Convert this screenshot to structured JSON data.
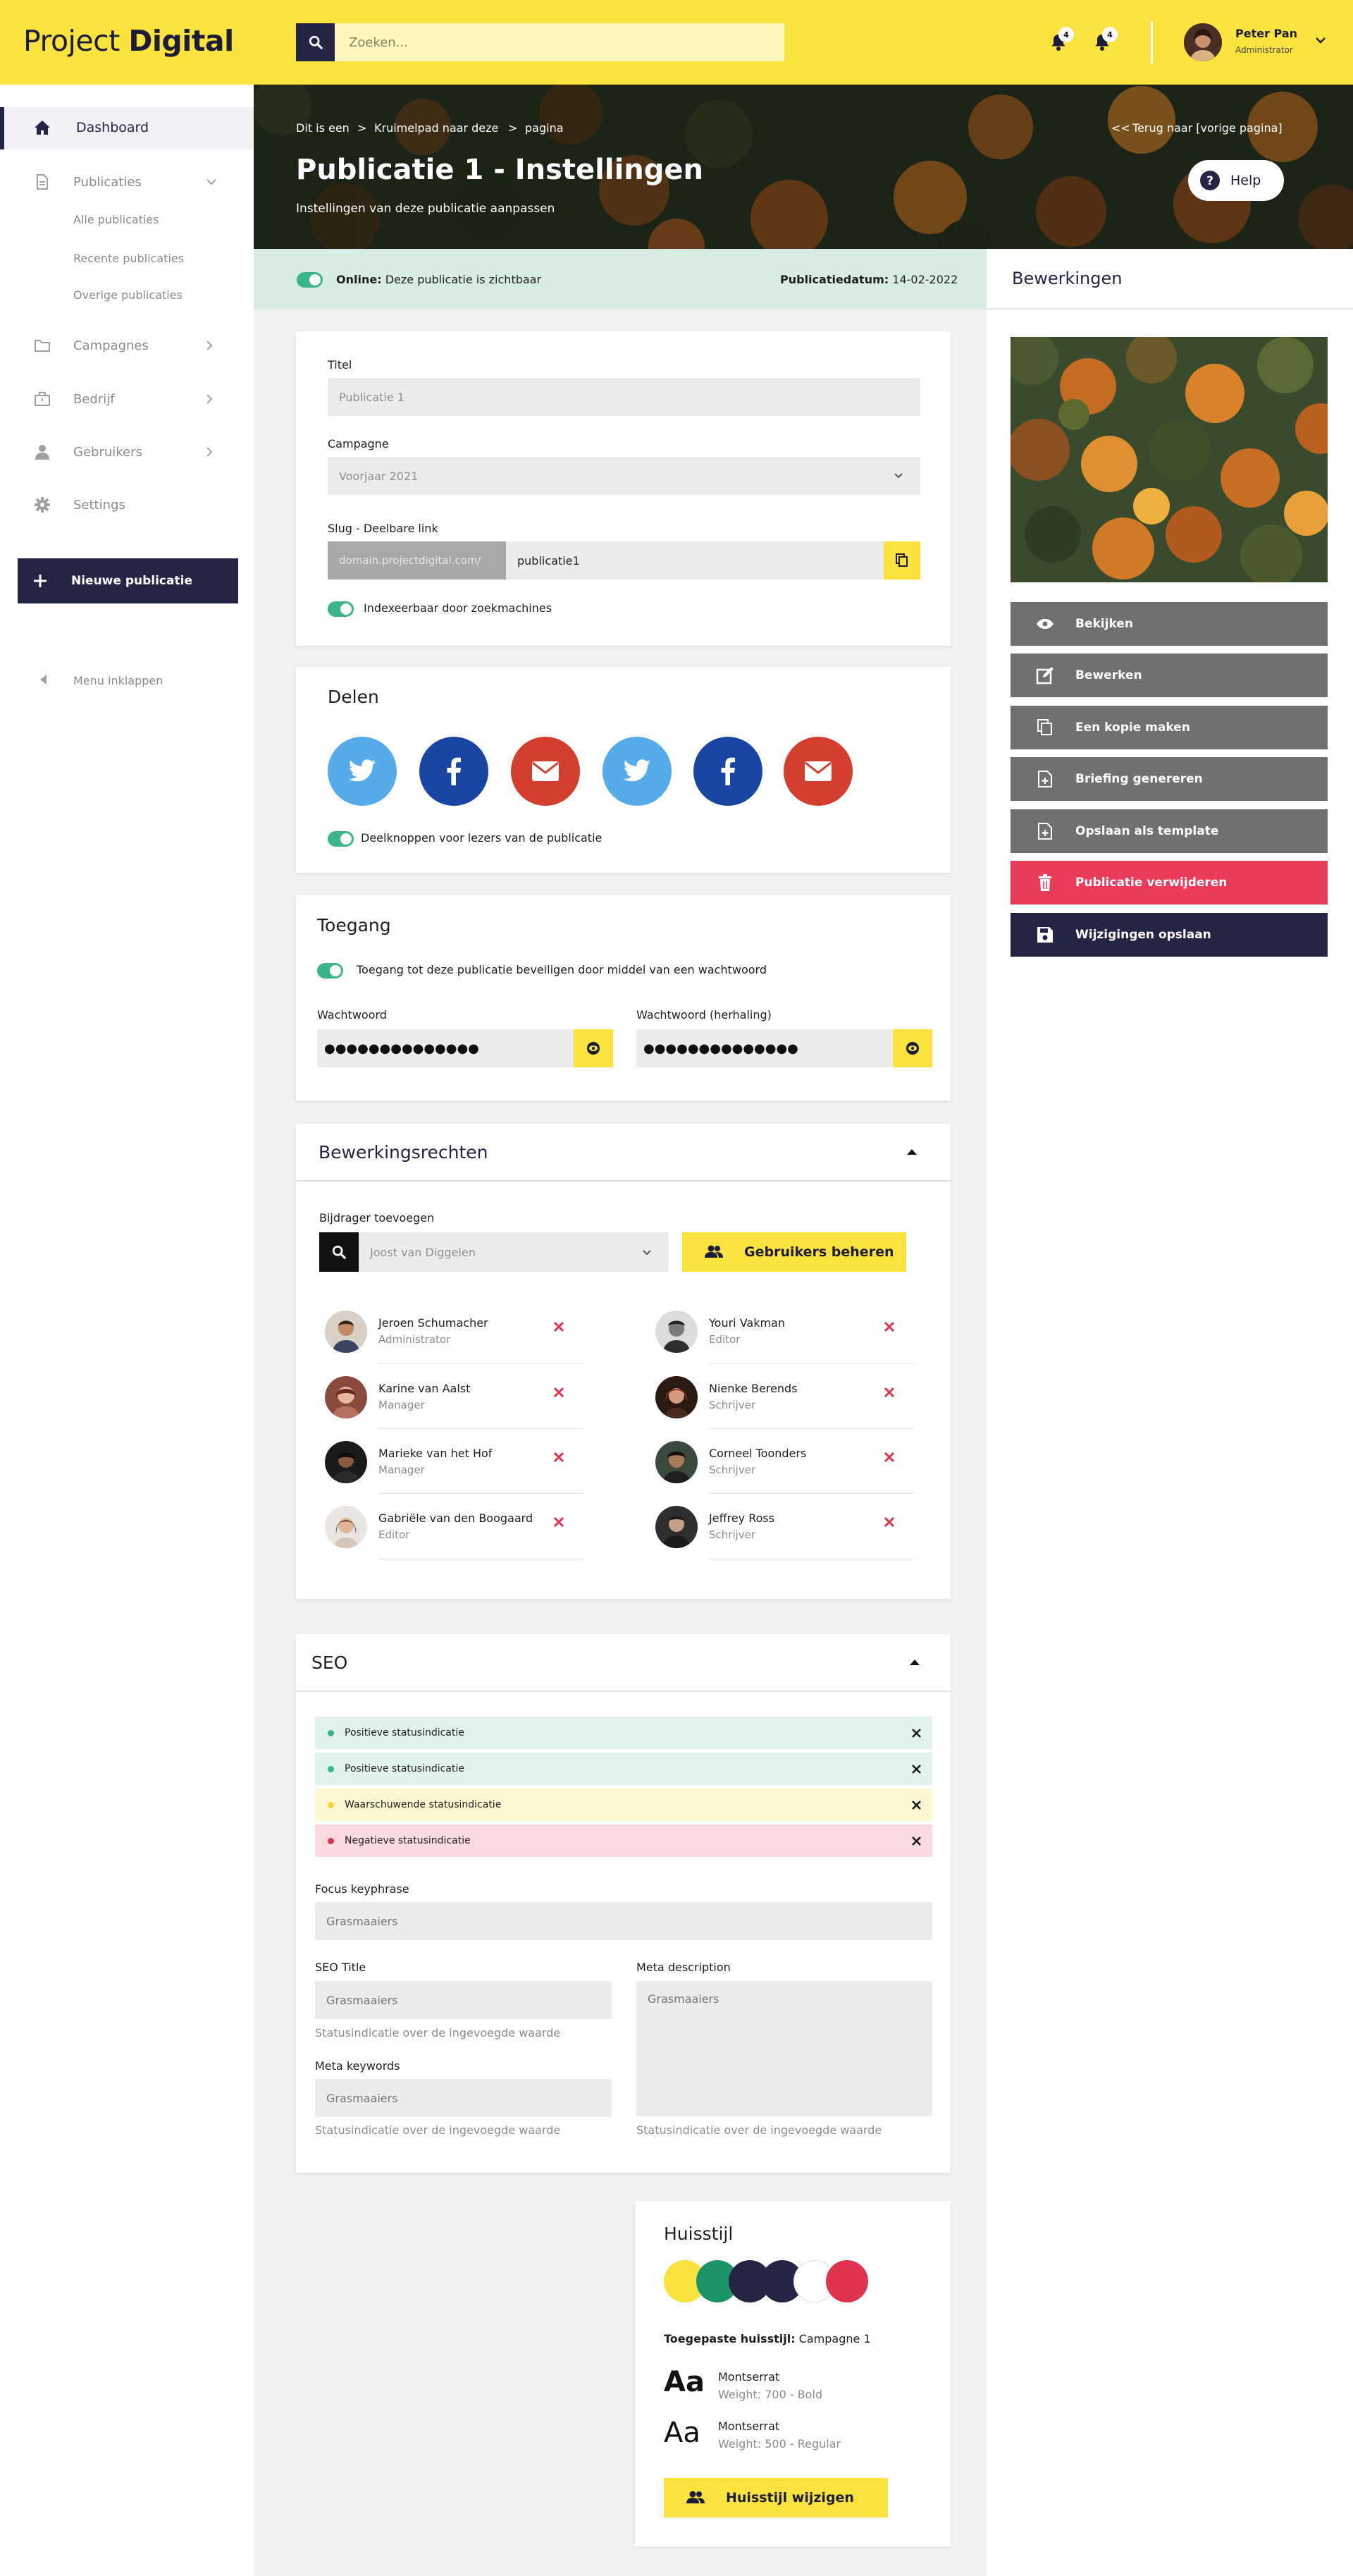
{
  "header": {
    "logo_light": "Project",
    "logo_bold": "Digital",
    "search_placeholder": "Zoeken...",
    "notif1_count": "4",
    "notif2_count": "4",
    "user_name": "Peter Pan",
    "user_role": "Administrator"
  },
  "sidebar": {
    "dashboard": "Dashboard",
    "publicaties": "Publicaties",
    "sub": [
      "Alle publicaties",
      "Recente publicaties",
      "Overige publicaties"
    ],
    "campagnes": "Campagnes",
    "bedrijf": "Bedrijf",
    "gebruikers": "Gebruikers",
    "settings": "Settings",
    "new_button": "Nieuwe publicatie",
    "collapse": "Menu inklappen"
  },
  "hero": {
    "crumb1": "Dit is een",
    "crumb2": "Kruimelpad naar deze",
    "crumb3": "pagina",
    "sep": ">",
    "back_arrows": "<<",
    "back": "Terug naar [vorige pagina]",
    "title": "Publicatie 1 - Instellingen",
    "subtitle": "Instellingen van deze publicatie aanpassen",
    "help": "Help"
  },
  "status": {
    "online_label": "Online:",
    "online_text": "Deze publicatie is zichtbaar",
    "date_label": "Publicatiedatum:",
    "date_value": "14-02-2022"
  },
  "general": {
    "title_label": "Titel",
    "title_value": "Publicatie 1",
    "campaign_label": "Campagne",
    "campaign_value": "Voorjaar 2021",
    "slug_label": "Slug - Deelbare link",
    "slug_prefix": "domain.projectdigital.com/",
    "slug_value": "publicatie1",
    "index_label": "Indexeerbaar door zoekmachines"
  },
  "share": {
    "title": "Delen",
    "toggle_label": "Deelknoppen voor lezers van de publicatie",
    "colors": {
      "twitter": "#56abe9",
      "facebook": "#1a45a3",
      "mail": "#d33e2e"
    }
  },
  "access": {
    "title": "Toegang",
    "toggle_label": "Toegang tot deze publicatie beveiligen door middel van een wachtwoord",
    "pw_label": "Wachtwoord",
    "pw2_label": "Wachtwoord (herhaling)",
    "pw_mask": "●●●●●●●●●●●●●●",
    "pw2_mask": "●●●●●●●●●●●●●●"
  },
  "rights": {
    "title": "Bewerkingsrechten",
    "add_label": "Bijdrager toevoegen",
    "select_value": "Joost van Diggelen",
    "manage_button": "Gebruikers beheren",
    "people": [
      {
        "name": "Jeroen Schumacher",
        "role": "Administrator"
      },
      {
        "name": "Youri Vakman",
        "role": "Editor"
      },
      {
        "name": "Karine van Aalst",
        "role": "Manager"
      },
      {
        "name": "Nienke Berends",
        "role": "Schrijver"
      },
      {
        "name": "Marieke van het Hof",
        "role": "Manager"
      },
      {
        "name": "Corneel Toonders",
        "role": "Schrijver"
      },
      {
        "name": "Gabriële van den Boogaard",
        "role": "Editor"
      },
      {
        "name": "Jeffrey Ross",
        "role": "Schrijver"
      }
    ]
  },
  "seo": {
    "title": "SEO",
    "statuses": [
      {
        "text": "Positieve statusindicatie",
        "bg": "#e1f3ec",
        "dot": "#3cb48c"
      },
      {
        "text": "Positieve statusindicatie",
        "bg": "#e1f3ec",
        "dot": "#3cb48c"
      },
      {
        "text": "Waarschuwende statusindicatie",
        "bg": "#fdf7d2",
        "dot": "#f3d53b"
      },
      {
        "text": "Negatieve statusindicatie",
        "bg": "#fadadf",
        "dot": "#e0334f"
      }
    ],
    "focus_label": "Focus keyphrase",
    "focus_placeholder": "Grasmaaiers",
    "seo_title_label": "SEO Title",
    "seo_title_placeholder": "Grasmaaiers",
    "seo_title_hint": "Statusindicatie over de ingevoegde waarde",
    "meta_desc_label": "Meta description",
    "meta_desc_placeholder": "Grasmaaiers",
    "meta_desc_hint": "Statusindicatie over de ingevoegde waarde",
    "meta_kw_label": "Meta keywords",
    "meta_kw_placeholder": "Grasmaaiers",
    "meta_kw_hint": "Statusindicatie over de ingevoegde waarde"
  },
  "style": {
    "title": "Huisstijl",
    "colors": [
      "#fae23f",
      "#1d9467",
      "#242445",
      "#242445",
      "#ffffff",
      "#e0334f"
    ],
    "applied_label": "Toegepaste huisstijl:",
    "applied_value": "Campagne 1",
    "font1_name": "Montserrat",
    "font1_weight": "Weight: 700 - Bold",
    "font2_name": "Montserrat",
    "font2_weight": "Weight: 500 - Regular",
    "sample": "Aa",
    "change_button": "Huisstijl wijzigen"
  },
  "actions": {
    "title": "Bewerkingen",
    "view": "Bekijken",
    "edit": "Bewerken",
    "copy": "Een kopie maken",
    "briefing": "Briefing genereren",
    "template": "Opslaan als template",
    "delete": "Publicatie verwijderen",
    "save": "Wijzigingen opslaan",
    "colors": {
      "neutral": "#707070",
      "danger": "#e83c5a",
      "primary": "#242445"
    }
  }
}
